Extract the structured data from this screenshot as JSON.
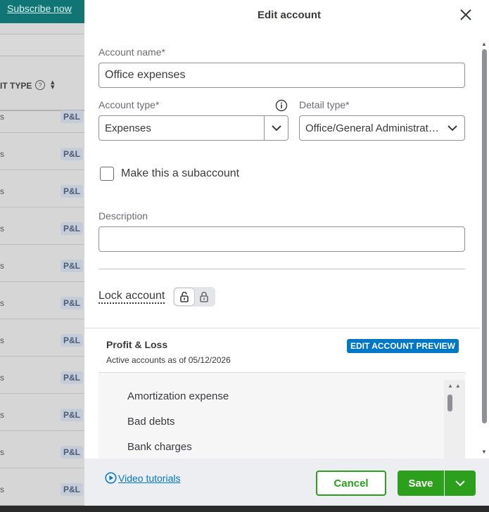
{
  "background": {
    "subscribe_link": "Subscribe now",
    "column_header": "IT TYPE",
    "help_glyph": "?",
    "rows": [
      {
        "left": "s",
        "badge": "P&L"
      },
      {
        "left": "s",
        "badge": "P&L"
      },
      {
        "left": "s",
        "badge": "P&L"
      },
      {
        "left": "s",
        "badge": "P&L"
      },
      {
        "left": "s",
        "badge": "P&L"
      },
      {
        "left": "s",
        "badge": "P&L"
      },
      {
        "left": "s",
        "badge": "P&L"
      },
      {
        "left": "s",
        "badge": "P&L"
      },
      {
        "left": "s",
        "badge": "P&L"
      },
      {
        "left": "s",
        "badge": "P&L"
      },
      {
        "left": "s",
        "badge": "P&L"
      }
    ]
  },
  "panel": {
    "title": "Edit account",
    "account_name_label": "Account name*",
    "account_name_value": "Office expenses",
    "account_type_label": "Account type*",
    "account_type_value": "Expenses",
    "detail_type_label": "Detail type*",
    "detail_type_value": "Office/General Administrative Expenses",
    "subaccount_label": "Make this a subaccount",
    "subaccount_checked": false,
    "description_label": "Description",
    "description_value": "",
    "lock_label": "Lock account",
    "lock_state": "unlocked"
  },
  "preview": {
    "title": "Profit & Loss",
    "subtitle": "Active accounts as of 05/12/2026",
    "badge": "EDIT ACCOUNT PREVIEW",
    "items": [
      "Amortization expense",
      "Bad debts",
      "Bank charges"
    ]
  },
  "footer": {
    "video_tutorials": "Video tutorials",
    "cancel": "Cancel",
    "save": "Save"
  },
  "colors": {
    "accent_green": "#2ca01c",
    "link_blue": "#0077c5",
    "banner_teal": "#127575"
  }
}
